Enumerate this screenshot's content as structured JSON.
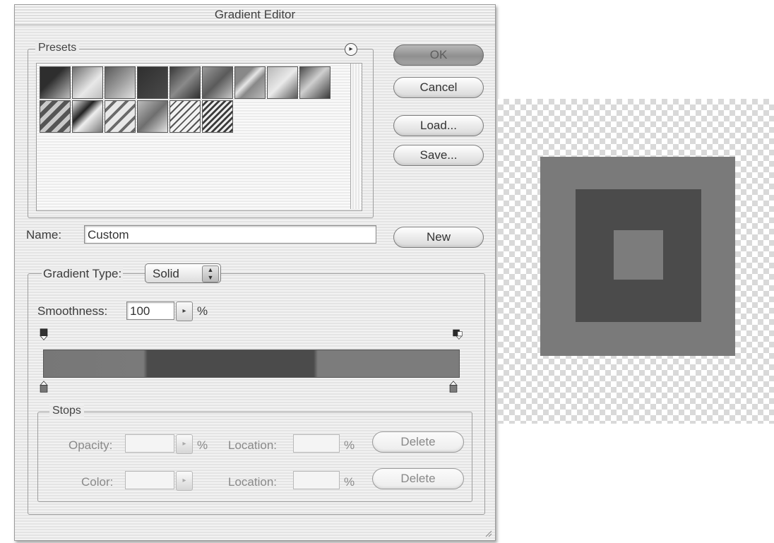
{
  "window": {
    "title": "Gradient Editor"
  },
  "presets": {
    "legend": "Presets",
    "menu_icon": "circle-arrow-icon",
    "swatches": [
      "a",
      "b",
      "c",
      "d",
      "e",
      "f",
      "g",
      "h",
      "i",
      "j",
      "k",
      "l",
      "m",
      "n",
      "o"
    ]
  },
  "buttons": {
    "ok": "OK",
    "cancel": "Cancel",
    "load": "Load...",
    "save": "Save...",
    "new": "New"
  },
  "name": {
    "label": "Name:",
    "value": "Custom"
  },
  "gradient_type": {
    "label": "Gradient Type:",
    "value": "Solid"
  },
  "smoothness": {
    "label": "Smoothness:",
    "value": "100",
    "unit": "%"
  },
  "gradient": {
    "colors": [
      "#777777",
      "#4b4b4b",
      "#7c7c7c"
    ]
  },
  "stops": {
    "legend": "Stops",
    "opacity_label": "Opacity:",
    "opacity_unit": "%",
    "location_label": "Location:",
    "location_unit": "%",
    "color_label": "Color:",
    "delete_label": "Delete"
  },
  "preview": {
    "outer_color": "#7a7a7a",
    "middle_color": "#4b4b4b",
    "inner_color": "#7c7c7c"
  }
}
